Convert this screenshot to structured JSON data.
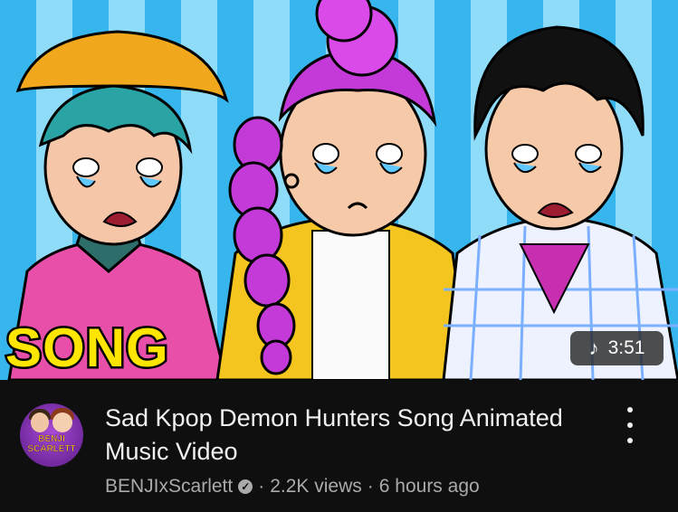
{
  "thumbnail": {
    "badge_text": "SONG",
    "duration": "3:51",
    "duration_icon": "music-note-icon",
    "colors": {
      "stripe_dark": "#37b6ee",
      "stripe_light": "#8fdcf9",
      "badge_yellow": "#ffe600"
    }
  },
  "video": {
    "title": "Sad Kpop Demon Hunters Song Animated Music Video",
    "channel": "BENJIxScarlett",
    "verified_icon": "verified-badge-icon",
    "separator": "·",
    "views": "2.2K views",
    "age": "6 hours ago"
  },
  "avatar": {
    "logo_text_1": "BENJI",
    "logo_text_2": "SCARLETT"
  },
  "menu": {
    "icon": "more-vert-icon"
  }
}
